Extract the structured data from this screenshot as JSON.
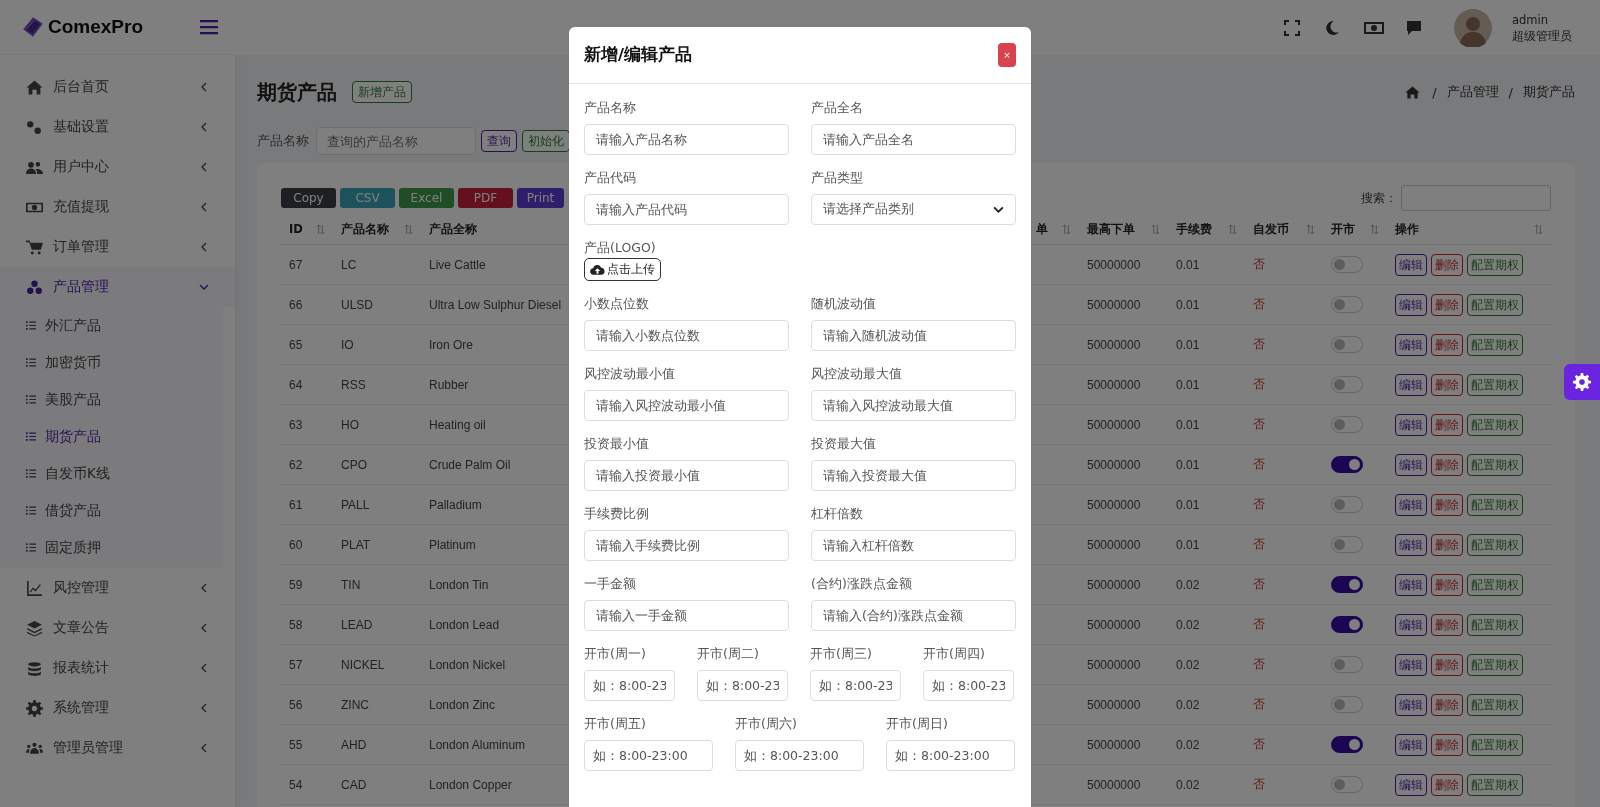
{
  "sidebar": {
    "logo": "ComexPro",
    "items": [
      {
        "label": "后台首页",
        "expanded": false
      },
      {
        "label": "基础设置",
        "expanded": false
      },
      {
        "label": "用户中心",
        "expanded": false
      },
      {
        "label": "充值提现",
        "expanded": false
      },
      {
        "label": "订单管理",
        "expanded": false
      },
      {
        "label": "产品管理",
        "expanded": true,
        "children": [
          {
            "label": "外汇产品",
            "selected": false
          },
          {
            "label": "加密货币",
            "selected": false
          },
          {
            "label": "美股产品",
            "selected": false
          },
          {
            "label": "期货产品",
            "selected": true
          },
          {
            "label": "自发币K线",
            "selected": false
          },
          {
            "label": "借贷产品",
            "selected": false
          },
          {
            "label": "固定质押",
            "selected": false
          }
        ]
      },
      {
        "label": "风控管理",
        "expanded": false
      },
      {
        "label": "文章公告",
        "expanded": false
      },
      {
        "label": "报表统计",
        "expanded": false
      },
      {
        "label": "系统管理",
        "expanded": false
      },
      {
        "label": "管理员管理",
        "expanded": false
      }
    ]
  },
  "header": {
    "user": {
      "name": "admin",
      "role": "超级管理员"
    }
  },
  "page": {
    "title": "期货产品",
    "add_button": "新增产品",
    "breadcrumb": [
      {
        "separator": "/",
        "label": "产品管理"
      },
      {
        "separator": "/",
        "label": "期货产品"
      }
    ],
    "filter": {
      "label": "产品名称",
      "placeholder": "查询的产品名称",
      "buttons": [
        {
          "label": "查询",
          "kind": "primary"
        },
        {
          "label": "初始化",
          "kind": "success"
        }
      ]
    }
  },
  "export_buttons": [
    {
      "label": "Copy",
      "kind": "dark"
    },
    {
      "label": "CSV",
      "kind": "info"
    },
    {
      "label": "Excel",
      "kind": "success"
    },
    {
      "label": "PDF",
      "kind": "danger"
    },
    {
      "label": "Print",
      "kind": "primary"
    }
  ],
  "table": {
    "search_label": "搜索：",
    "columns": [
      {
        "label": "ID",
        "sortable": true
      },
      {
        "label": "产品名称",
        "sortable": true
      },
      {
        "label": "产品全称"
      },
      {
        "label": "单",
        "sortable": true
      },
      {
        "label": "最高下单",
        "sortable": true
      },
      {
        "label": "手续费",
        "sortable": true
      },
      {
        "label": "自发币",
        "sortable": true
      },
      {
        "label": "开市",
        "sortable": true
      },
      {
        "label": "操作",
        "sortable": true
      }
    ],
    "rows": [
      {
        "id": "67",
        "name": "LC",
        "full_name": "Live Cattle",
        "max_order": "50000000",
        "fee": "0.01",
        "self_issued": "否",
        "open": false,
        "actions": [
          "编辑",
          "删除",
          "配置期权"
        ]
      },
      {
        "id": "66",
        "name": "ULSD",
        "full_name": "Ultra Low Sulphur Diesel",
        "max_order": "50000000",
        "fee": "0.01",
        "self_issued": "否",
        "open": false,
        "actions": [
          "编辑",
          "删除",
          "配置期权"
        ]
      },
      {
        "id": "65",
        "name": "IO",
        "full_name": "Iron Ore",
        "max_order": "50000000",
        "fee": "0.01",
        "self_issued": "否",
        "open": false,
        "actions": [
          "编辑",
          "删除",
          "配置期权"
        ]
      },
      {
        "id": "64",
        "name": "RSS",
        "full_name": "Rubber",
        "max_order": "50000000",
        "fee": "0.01",
        "self_issued": "否",
        "open": false,
        "actions": [
          "编辑",
          "删除",
          "配置期权"
        ]
      },
      {
        "id": "63",
        "name": "HO",
        "full_name": "Heating oil",
        "max_order": "50000000",
        "fee": "0.01",
        "self_issued": "否",
        "open": false,
        "actions": [
          "编辑",
          "删除",
          "配置期权"
        ]
      },
      {
        "id": "62",
        "name": "CPO",
        "full_name": "Crude Palm Oil",
        "max_order": "50000000",
        "fee": "0.01",
        "self_issued": "否",
        "open": true,
        "actions": [
          "编辑",
          "删除",
          "配置期权"
        ]
      },
      {
        "id": "61",
        "name": "PALL",
        "full_name": "Palladium",
        "max_order": "50000000",
        "fee": "0.01",
        "self_issued": "否",
        "open": false,
        "actions": [
          "编辑",
          "删除",
          "配置期权"
        ]
      },
      {
        "id": "60",
        "name": "PLAT",
        "full_name": "Platinum",
        "max_order": "50000000",
        "fee": "0.01",
        "self_issued": "否",
        "open": false,
        "actions": [
          "编辑",
          "删除",
          "配置期权"
        ]
      },
      {
        "id": "59",
        "name": "TIN",
        "full_name": "London Tin",
        "max_order": "50000000",
        "fee": "0.02",
        "self_issued": "否",
        "open": true,
        "actions": [
          "编辑",
          "删除",
          "配置期权"
        ]
      },
      {
        "id": "58",
        "name": "LEAD",
        "full_name": "London Lead",
        "max_order": "50000000",
        "fee": "0.02",
        "self_issued": "否",
        "open": true,
        "actions": [
          "编辑",
          "删除",
          "配置期权"
        ]
      },
      {
        "id": "57",
        "name": "NICKEL",
        "full_name": "London Nickel",
        "max_order": "50000000",
        "fee": "0.02",
        "self_issued": "否",
        "open": false,
        "actions": [
          "编辑",
          "删除",
          "配置期权"
        ]
      },
      {
        "id": "56",
        "name": "ZINC",
        "full_name": "London Zinc",
        "max_order": "50000000",
        "fee": "0.02",
        "self_issued": "否",
        "open": false,
        "actions": [
          "编辑",
          "删除",
          "配置期权"
        ]
      },
      {
        "id": "55",
        "name": "AHD",
        "full_name": "London Aluminum",
        "max_order": "50000000",
        "fee": "0.02",
        "self_issued": "否",
        "open": true,
        "actions": [
          "编辑",
          "删除",
          "配置期权"
        ]
      },
      {
        "id": "54",
        "name": "CAD",
        "full_name": "London Copper",
        "max_order": "50000000",
        "fee": "0.02",
        "self_issued": "否",
        "open": false,
        "actions": [
          "编辑",
          "删除",
          "配置期权"
        ]
      }
    ]
  },
  "modal": {
    "title": "新增/编辑产品",
    "close": "×",
    "fields": [
      {
        "label": "产品名称",
        "placeholder": "请输入产品名称",
        "kind": "text"
      },
      {
        "label": "产品全名",
        "placeholder": "请输入产品全名",
        "kind": "text"
      },
      {
        "label": "产品代码",
        "placeholder": "请输入产品代码",
        "kind": "text"
      },
      {
        "label": "产品类型",
        "placeholder": "请选择产品类别",
        "kind": "select"
      },
      {
        "label": "产品(LOGO)",
        "button": "点击上传",
        "kind": "upload"
      },
      {
        "label": "小数点位数",
        "placeholder": "请输入小数点位数",
        "kind": "text"
      },
      {
        "label": "随机波动值",
        "placeholder": "请输入随机波动值",
        "kind": "text"
      },
      {
        "label": "风控波动最小值",
        "placeholder": "请输入风控波动最小值",
        "kind": "text"
      },
      {
        "label": "风控波动最大值",
        "placeholder": "请输入风控波动最大值",
        "kind": "text"
      },
      {
        "label": "投资最小值",
        "placeholder": "请输入投资最小值",
        "kind": "text"
      },
      {
        "label": "投资最大值",
        "placeholder": "请输入投资最大值",
        "kind": "text"
      },
      {
        "label": "手续费比例",
        "placeholder": "请输入手续费比例",
        "kind": "text"
      },
      {
        "label": "杠杆倍数",
        "placeholder": "请输入杠杆倍数",
        "kind": "text"
      },
      {
        "label": "一手金额",
        "placeholder": "请输入一手金额",
        "kind": "text"
      },
      {
        "label": "(合约)涨跌点金额",
        "placeholder": "请输入(合约)涨跌点金额",
        "kind": "text"
      }
    ],
    "hour_rows": [
      [
        {
          "label": "开市(周一)",
          "placeholder": "如：8:00-23"
        },
        {
          "label": "开市(周二)",
          "placeholder": "如：8:00-23"
        },
        {
          "label": "开市(周三)",
          "placeholder": "如：8:00-23"
        },
        {
          "label": "开市(周四)",
          "placeholder": "如：8:00-23"
        }
      ],
      [
        {
          "label": "开市(周五)",
          "placeholder": "如：8:00-23:00"
        },
        {
          "label": "开市(周六)",
          "placeholder": "如：8:00-23:00"
        },
        {
          "label": "开市(周日)",
          "placeholder": "如：8:00-23:00"
        }
      ]
    ]
  }
}
